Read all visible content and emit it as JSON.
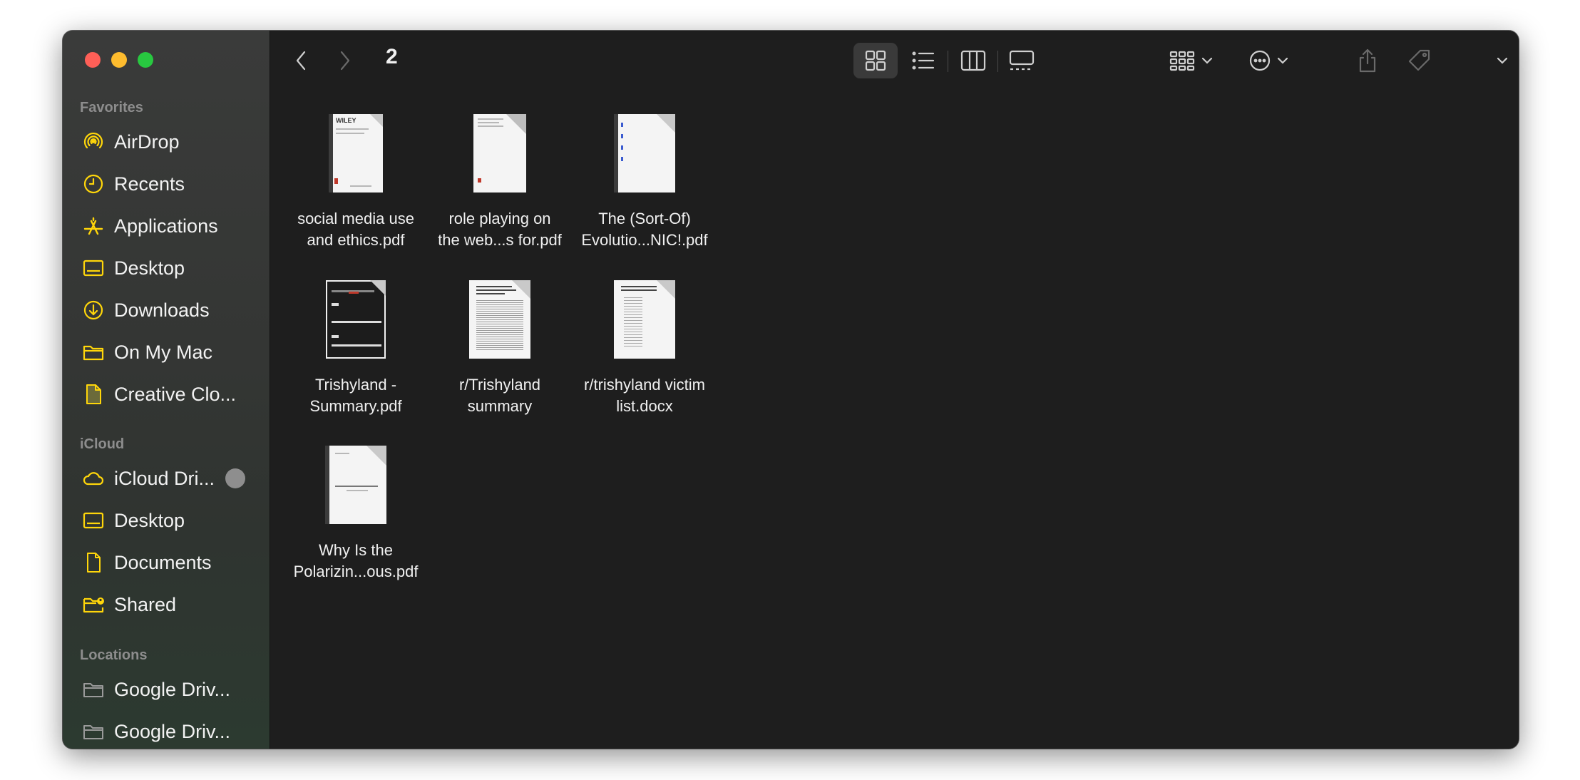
{
  "window": {
    "title": "2"
  },
  "sidebar": {
    "sections": [
      {
        "label": "Favorites",
        "items": [
          {
            "label": "AirDrop",
            "icon": "airdrop-icon"
          },
          {
            "label": "Recents",
            "icon": "clock-icon"
          },
          {
            "label": "Applications",
            "icon": "applications-icon"
          },
          {
            "label": "Desktop",
            "icon": "desktop-icon"
          },
          {
            "label": "Downloads",
            "icon": "download-icon"
          },
          {
            "label": "On My Mac",
            "icon": "folder-icon"
          },
          {
            "label": "Creative Clo...",
            "icon": "document-icon"
          }
        ]
      },
      {
        "label": "iCloud",
        "items": [
          {
            "label": "iCloud Dri...",
            "icon": "cloud-icon"
          },
          {
            "label": "Desktop",
            "icon": "desktop-icon"
          },
          {
            "label": "Documents",
            "icon": "document-icon"
          },
          {
            "label": "Shared",
            "icon": "shared-folder-icon"
          }
        ]
      },
      {
        "label": "Locations",
        "items": [
          {
            "label": "Google Driv...",
            "icon": "drive-icon"
          },
          {
            "label": "Google Driv...",
            "icon": "drive-icon"
          }
        ]
      }
    ]
  },
  "files": [
    {
      "line1": "social media use",
      "line2": "and ethics.pdf"
    },
    {
      "line1": "role playing on",
      "line2": "the web...s for.pdf"
    },
    {
      "line1": "The (Sort-Of)",
      "line2": "Evolutio...NIC!.pdf"
    },
    {
      "line1": "Trishyland -",
      "line2": "Summary.pdf"
    },
    {
      "line1": "r/Trishyland",
      "line2": "summary"
    },
    {
      "line1": "r/trishyland victim",
      "line2": "list.docx"
    },
    {
      "line1": "Why Is the",
      "line2": "Polarizin...ous.pdf"
    }
  ],
  "thumb_text": {
    "wiley": "WILEY"
  },
  "colors": {
    "accent": "#ffd60a",
    "window_bg": "#1e1e1e"
  }
}
